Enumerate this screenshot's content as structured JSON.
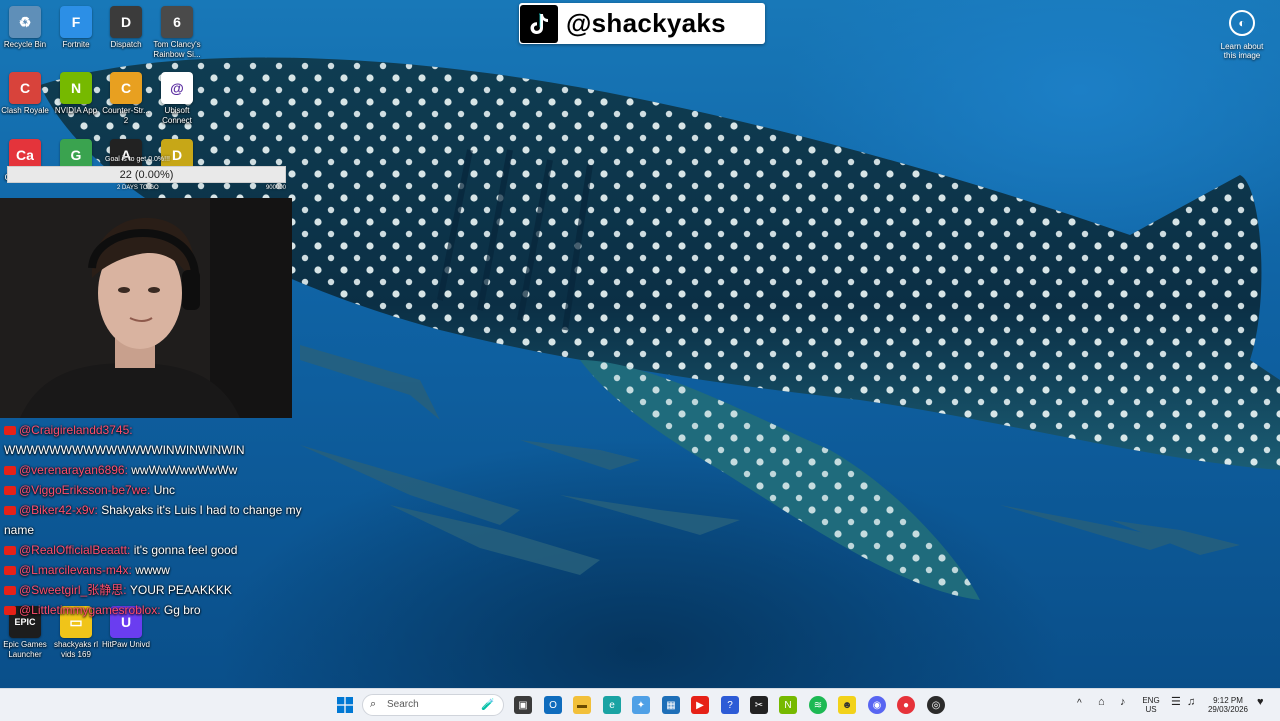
{
  "overlay": {
    "tiktok_handle": "@shackyaks",
    "learn_label": "Learn about this image"
  },
  "desktop_icons": [
    {
      "label": "Recycle Bin",
      "color": "#5f8fb8",
      "glyph": "♻"
    },
    {
      "label": "Fortnite",
      "color": "#2c8fe6",
      "glyph": "F"
    },
    {
      "label": "Dispatch",
      "color": "#3b3b3b",
      "glyph": "D"
    },
    {
      "label": "Tom Clancy's Rainbow Si...",
      "color": "#4a4a4a",
      "glyph": "6"
    },
    {
      "label": "Clash Royale",
      "color": "#d8433b",
      "glyph": "C"
    },
    {
      "label": "NVIDIA App",
      "color": "#76b900",
      "glyph": "N"
    },
    {
      "label": "Counter-Str... 2",
      "color": "#e8a020",
      "glyph": "C"
    },
    {
      "label": "Ubisoft Connect",
      "color": "#ffffff",
      "glyph": "@"
    },
    {
      "label": "Caffeinated",
      "color": "#e4343b",
      "glyph": "Ca"
    },
    {
      "label": "Games",
      "color": "#3aa34f",
      "glyph": "G"
    },
    {
      "label": "ARC Raiders",
      "color": "#222222",
      "glyph": "A"
    },
    {
      "label": "Dash",
      "color": "#c7a717",
      "glyph": "D"
    },
    {
      "label": "Epic Games Launcher",
      "color": "#1d1d1d",
      "glyph": "EPIC"
    },
    {
      "label": "shackyaks rl vids 169",
      "color": "#f0c419",
      "glyph": "▭"
    },
    {
      "label": "HitPaw Univd",
      "color": "#6a3df0",
      "glyph": "U"
    }
  ],
  "goal": {
    "title": "Goal is to get 0.0%!!!",
    "value_text": "22 (0.00%)",
    "progress": 0.0,
    "days_left": "2 DAYS TO GO",
    "target": "900000"
  },
  "chat": [
    {
      "user": "@Craigirelandd3745:",
      "text": ""
    },
    {
      "user": "",
      "text": "WWWWWWWWWWWWWWINWINWINWIN"
    },
    {
      "user": "@verenarayan6896:",
      "text": "wwWwWwwWwWw"
    },
    {
      "user": "@ViggoEriksson-be7we:",
      "text": "Unc"
    },
    {
      "user": "@Biker42-x9v:",
      "text": "Shakyaks it's Luis I had to change my name"
    },
    {
      "user": "@RealOfficialBeaatt:",
      "text": "it's gonna feel good"
    },
    {
      "user": "@Lmarcilevans-m4x:",
      "text": "wwww"
    },
    {
      "user": "@Sweetgirl_张静思:",
      "text": "YOUR PEAAKKKK"
    },
    {
      "user": "@Littletimmygamesroblox:",
      "text": "Gg bro"
    }
  ],
  "taskbar": {
    "search_placeholder": "Search",
    "lang_top": "ENG",
    "lang_bottom": "US",
    "time": "9:12 PM",
    "date": "29/03/2026"
  },
  "colors": {
    "chat_user": "#ff4d6d",
    "taskbar_bg": "#eef1f6",
    "windows_blue": "#0078d4"
  }
}
